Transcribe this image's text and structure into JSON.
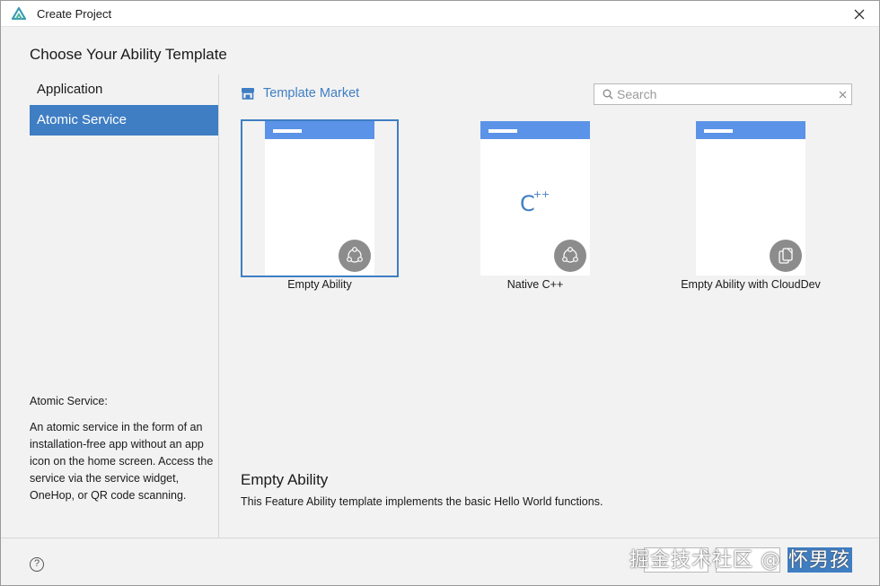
{
  "window": {
    "title": "Create Project"
  },
  "heading": "Choose Your Ability Template",
  "sidebar": {
    "items": [
      {
        "label": "Application"
      },
      {
        "label": "Atomic Service"
      }
    ],
    "description_title": "Atomic Service:",
    "description": "An atomic service in the form of an installation-free app without an app icon on the home screen. Access the service via the service widget, OneHop, or QR code scanning."
  },
  "market": {
    "label": "Template Market"
  },
  "search": {
    "placeholder": "Search",
    "value": ""
  },
  "templates": [
    {
      "label": "Empty Ability",
      "badge": "atomic-service-icon"
    },
    {
      "label": "Native C++",
      "glyph": "C",
      "glyph_sup": "++",
      "badge": "atomic-service-icon"
    },
    {
      "label": "Empty Ability with CloudDev",
      "badge": "cloud-dev-icon"
    }
  ],
  "selected_template": "Empty Ability",
  "detail": {
    "title": "Empty Ability",
    "text": "This Feature Ability template implements the basic Hello World functions."
  },
  "footer": {
    "help_glyph": "?",
    "cancel_label": "",
    "previous_label": "",
    "next_label": ""
  },
  "watermark": "掘金技术社区 @ 怀男孩",
  "colors": {
    "accent": "#3f7ec3",
    "card_header": "#5b93e8",
    "badge": "#8c8c8c"
  }
}
